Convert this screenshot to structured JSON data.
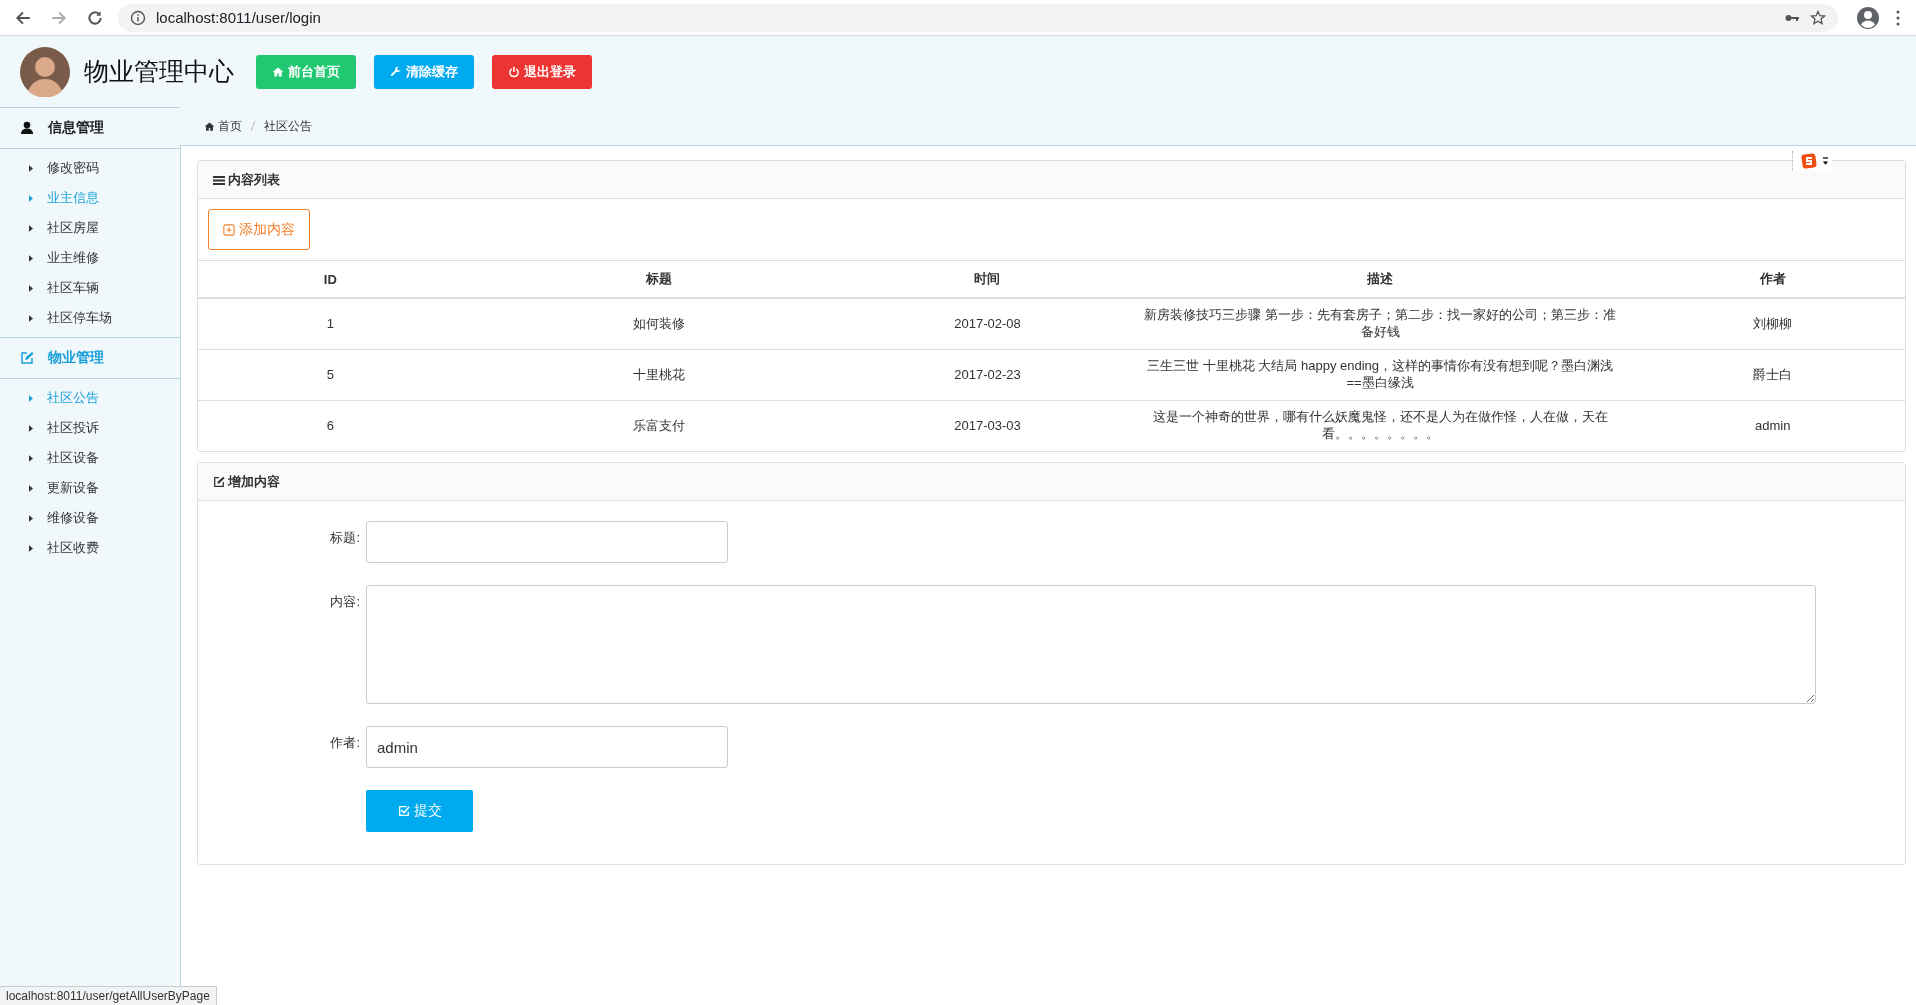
{
  "browser": {
    "url": "localhost:8011/user/login",
    "status_url": "localhost:8011/user/getAllUserByPage"
  },
  "header": {
    "title": "物业管理中心",
    "buttons": [
      {
        "label": "前台首页",
        "kind": "home"
      },
      {
        "label": "清除缓存",
        "kind": "clear"
      },
      {
        "label": "退出登录",
        "kind": "logout"
      }
    ]
  },
  "sidebar": {
    "groups": [
      {
        "label": "信息管理",
        "kind": "user",
        "selected": false,
        "items": [
          {
            "label": "修改密码",
            "selected": false
          },
          {
            "label": "业主信息",
            "selected": true
          },
          {
            "label": "社区房屋",
            "selected": false
          },
          {
            "label": "业主维修",
            "selected": false
          },
          {
            "label": "社区车辆",
            "selected": false
          },
          {
            "label": "社区停车场",
            "selected": false
          }
        ]
      },
      {
        "label": "物业管理",
        "kind": "edit",
        "selected": true,
        "items": [
          {
            "label": "社区公告",
            "selected": true
          },
          {
            "label": "社区投诉",
            "selected": false
          },
          {
            "label": "社区设备",
            "selected": false
          },
          {
            "label": "更新设备",
            "selected": false
          },
          {
            "label": "维修设备",
            "selected": false
          },
          {
            "label": "社区收费",
            "selected": false
          }
        ]
      }
    ]
  },
  "breadcrumb": [
    {
      "label": "首页",
      "kind": "home"
    },
    {
      "label": "社区公告",
      "kind": "page"
    }
  ],
  "list_panel": {
    "title": "内容列表",
    "add_button": "添加内容",
    "table": {
      "columns": [
        "ID",
        "标题",
        "时间",
        "描述",
        "作者"
      ],
      "rows": [
        [
          "1",
          "如何装修",
          "2017-02-08",
          "新房装修技巧三步骤 第一步：先有套房子；第二步：找一家好的公司；第三步：准备好钱",
          "刘柳柳"
        ],
        [
          "5",
          "十里桃花",
          "2017-02-23",
          "三生三世 十里桃花 大结局 happy ending，这样的事情你有没有想到呢？墨白渊浅==墨白缘浅",
          "爵士白"
        ],
        [
          "6",
          "乐富支付",
          "2017-03-03",
          "这是一个神奇的世界，哪有什么妖魔鬼怪，还不是人为在做作怪，人在做，天在看。。。。。。。。",
          "admin"
        ]
      ]
    }
  },
  "form_panel": {
    "title": "增加内容",
    "fields": [
      {
        "label": "标题:",
        "kind": "text"
      },
      {
        "label": "内容:",
        "kind": "textarea"
      },
      {
        "label": "作者:",
        "kind": "text",
        "value": "admin"
      }
    ],
    "submit": "提交"
  }
}
